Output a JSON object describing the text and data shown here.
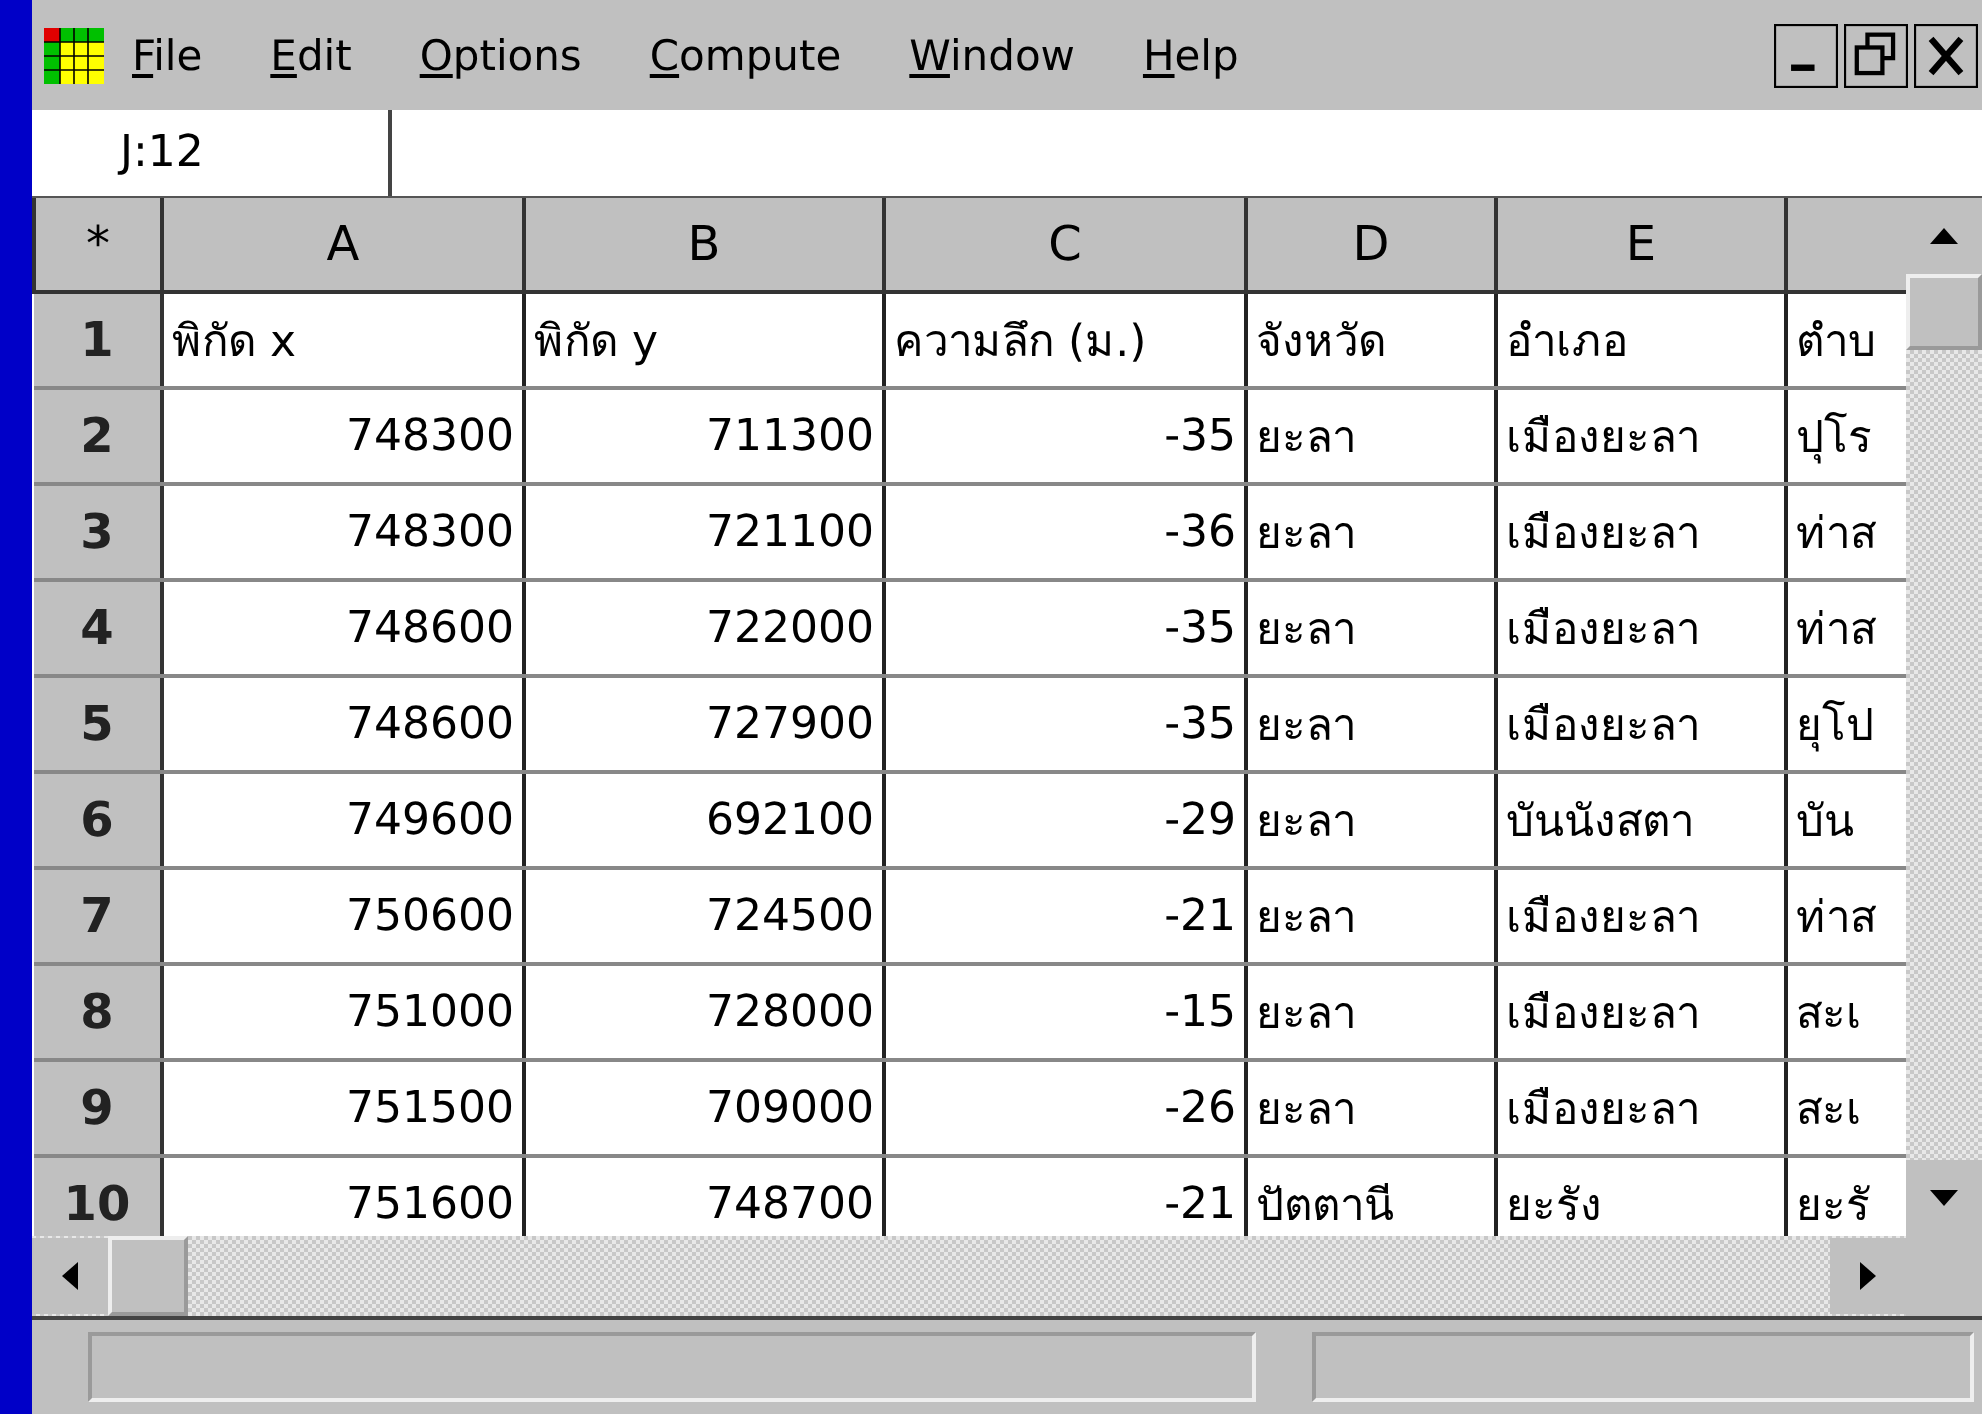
{
  "menu": [
    {
      "label": "File"
    },
    {
      "label": "Edit"
    },
    {
      "label": "Options"
    },
    {
      "label": "Compute"
    },
    {
      "label": "Window"
    },
    {
      "label": "Help"
    }
  ],
  "cell_reference": "J:12",
  "corner": "*",
  "columns": [
    {
      "label": "A",
      "kind": "number"
    },
    {
      "label": "B",
      "kind": "number"
    },
    {
      "label": "C",
      "kind": "number"
    },
    {
      "label": "D",
      "kind": "text"
    },
    {
      "label": "E",
      "kind": "text"
    },
    {
      "kind": "text"
    }
  ],
  "rows": [
    {
      "number": "1",
      "kind": "header",
      "cells": [
        "พิกัด x",
        "พิกัด y",
        "ความลึก (ม.)",
        "จังหวัด",
        "อำเภอ",
        "ตำบ"
      ]
    },
    {
      "number": "2",
      "kind": "data",
      "cells": [
        "748300",
        "711300",
        "-35",
        "ยะลา",
        "เมืองยะลา",
        "ปุโร"
      ]
    },
    {
      "number": "3",
      "kind": "data",
      "cells": [
        "748300",
        "721100",
        "-36",
        "ยะลา",
        "เมืองยะลา",
        "ท่าส"
      ]
    },
    {
      "number": "4",
      "kind": "data",
      "cells": [
        "748600",
        "722000",
        "-35",
        "ยะลา",
        "เมืองยะลา",
        "ท่าส"
      ]
    },
    {
      "number": "5",
      "kind": "data",
      "cells": [
        "748600",
        "727900",
        "-35",
        "ยะลา",
        "เมืองยะลา",
        "ยุโป"
      ]
    },
    {
      "number": "6",
      "kind": "data",
      "cells": [
        "749600",
        "692100",
        "-29",
        "ยะลา",
        "บันนังสตา",
        "บัน"
      ]
    },
    {
      "number": "7",
      "kind": "data",
      "cells": [
        "750600",
        "724500",
        "-21",
        "ยะลา",
        "เมืองยะลา",
        "ท่าส"
      ]
    },
    {
      "number": "8",
      "kind": "data",
      "cells": [
        "751000",
        "728000",
        "-15",
        "ยะลา",
        "เมืองยะลา",
        "สะเ"
      ]
    },
    {
      "number": "9",
      "kind": "data",
      "cells": [
        "751500",
        "709000",
        "-26",
        "ยะลา",
        "เมืองยะลา",
        "สะเ"
      ]
    },
    {
      "number": "10",
      "kind": "data",
      "cells": [
        "751600",
        "748700",
        "-21",
        "ปัตตานี",
        "ยะรัง",
        "ยะรั"
      ]
    }
  ]
}
